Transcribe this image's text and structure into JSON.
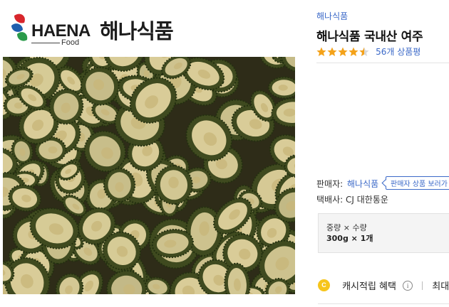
{
  "brand_logo": {
    "name_en": "HAENA",
    "sub_en": "Food",
    "name_ko": "해나식품",
    "colors": {
      "red": "#d8262c",
      "blue": "#1f5fae",
      "green": "#2a9a4a"
    }
  },
  "product_image": {
    "subject": "dried bitter melon slices",
    "colors": {
      "rind": "#3f4a1f",
      "flesh": "#d9cc98",
      "seed": "#c8b77a",
      "shadow": "#2e2c18"
    }
  },
  "product": {
    "brand_link": "해나식품",
    "title": "해나식품 국내산 여주",
    "rating": {
      "stars": 4.5,
      "review_count": "56개 상품평"
    },
    "seller": {
      "label": "판매자:",
      "name": "해나식품",
      "button": "판매자 상품 보러가"
    },
    "delivery": {
      "label": "택배사:",
      "value": "CJ 대한통운"
    },
    "option": {
      "label": "중량 × 수량",
      "value": "300g × 1개"
    },
    "cashback": {
      "icon_text": "C",
      "label": "캐시적립 혜택",
      "info_icon": "i",
      "max_label": "최대"
    },
    "colors": {
      "link": "#3b69c8",
      "star": "#f4a21a",
      "cash": "#f6c51b"
    }
  }
}
